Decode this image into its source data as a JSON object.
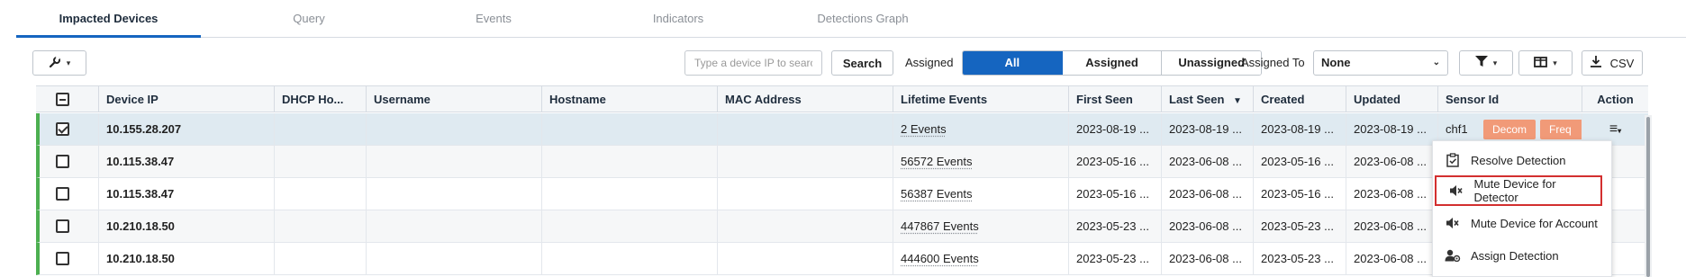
{
  "tabs": [
    {
      "label": "Impacted Devices",
      "active": true
    },
    {
      "label": "Query",
      "active": false
    },
    {
      "label": "Events",
      "active": false
    },
    {
      "label": "Indicators",
      "active": false
    },
    {
      "label": "Detections Graph",
      "active": false
    }
  ],
  "toolbar": {
    "search_placeholder": "Type a device IP to search",
    "search_label": "Search",
    "assigned_label": "Assigned",
    "filter_options": [
      "All",
      "Assigned",
      "Unassigned"
    ],
    "active_filter": "All",
    "assigned_to_label": "Assigned To",
    "assigned_to_value": "None",
    "csv_label": "CSV"
  },
  "table": {
    "columns": [
      "Device IP",
      "DHCP Ho...",
      "Username",
      "Hostname",
      "MAC Address",
      "Lifetime Events",
      "First Seen",
      "Last Seen",
      "Created",
      "Updated",
      "Sensor Id",
      "Action"
    ],
    "rows": [
      {
        "checked": true,
        "device_ip": "10.155.28.207",
        "dhcp": "",
        "username": "",
        "hostname": "",
        "mac": "",
        "lifetime_events": "2 Events",
        "first_seen": "2023-08-19 ...",
        "last_seen": "2023-08-19 ...",
        "created": "2023-08-19 ...",
        "updated": "2023-08-19 ...",
        "sensor_id": "chf1",
        "tags": [
          "Decom",
          "Freq"
        ]
      },
      {
        "checked": false,
        "device_ip": "10.115.38.47",
        "dhcp": "",
        "username": "",
        "hostname": "",
        "mac": "",
        "lifetime_events": "56572 Events",
        "first_seen": "2023-05-16 ...",
        "last_seen": "2023-06-08 ...",
        "created": "2023-05-16 ...",
        "updated": "2023-06-08 ..."
      },
      {
        "checked": false,
        "device_ip": "10.115.38.47",
        "dhcp": "",
        "username": "",
        "hostname": "",
        "mac": "",
        "lifetime_events": "56387 Events",
        "first_seen": "2023-05-16 ...",
        "last_seen": "2023-06-08 ...",
        "created": "2023-05-16 ...",
        "updated": "2023-06-08 ..."
      },
      {
        "checked": false,
        "device_ip": "10.210.18.50",
        "dhcp": "",
        "username": "",
        "hostname": "",
        "mac": "",
        "lifetime_events": "447867 Events",
        "first_seen": "2023-05-23 ...",
        "last_seen": "2023-06-08 ...",
        "created": "2023-05-23 ...",
        "updated": "2023-06-08 ..."
      },
      {
        "checked": false,
        "device_ip": "10.210.18.50",
        "dhcp": "",
        "username": "",
        "hostname": "",
        "mac": "",
        "lifetime_events": "444600 Events",
        "first_seen": "2023-05-23 ...",
        "last_seen": "2023-06-08 ...",
        "created": "2023-05-23 ...",
        "updated": "2023-06-08 ..."
      }
    ]
  },
  "action_menu": {
    "items": [
      {
        "label": "Resolve Detection",
        "icon": "clipboard-check-icon"
      },
      {
        "label": "Mute Device for Detector",
        "icon": "mute-icon",
        "highlighted": true
      },
      {
        "label": "Mute Device for Account",
        "icon": "mute-icon"
      },
      {
        "label": "Assign Detection",
        "icon": "user-assign-icon"
      }
    ]
  },
  "colors": {
    "accent": "#1565c0",
    "tag": "#f19a78",
    "row_indicator": "#4caf50",
    "highlight_border": "#d32f2f"
  }
}
